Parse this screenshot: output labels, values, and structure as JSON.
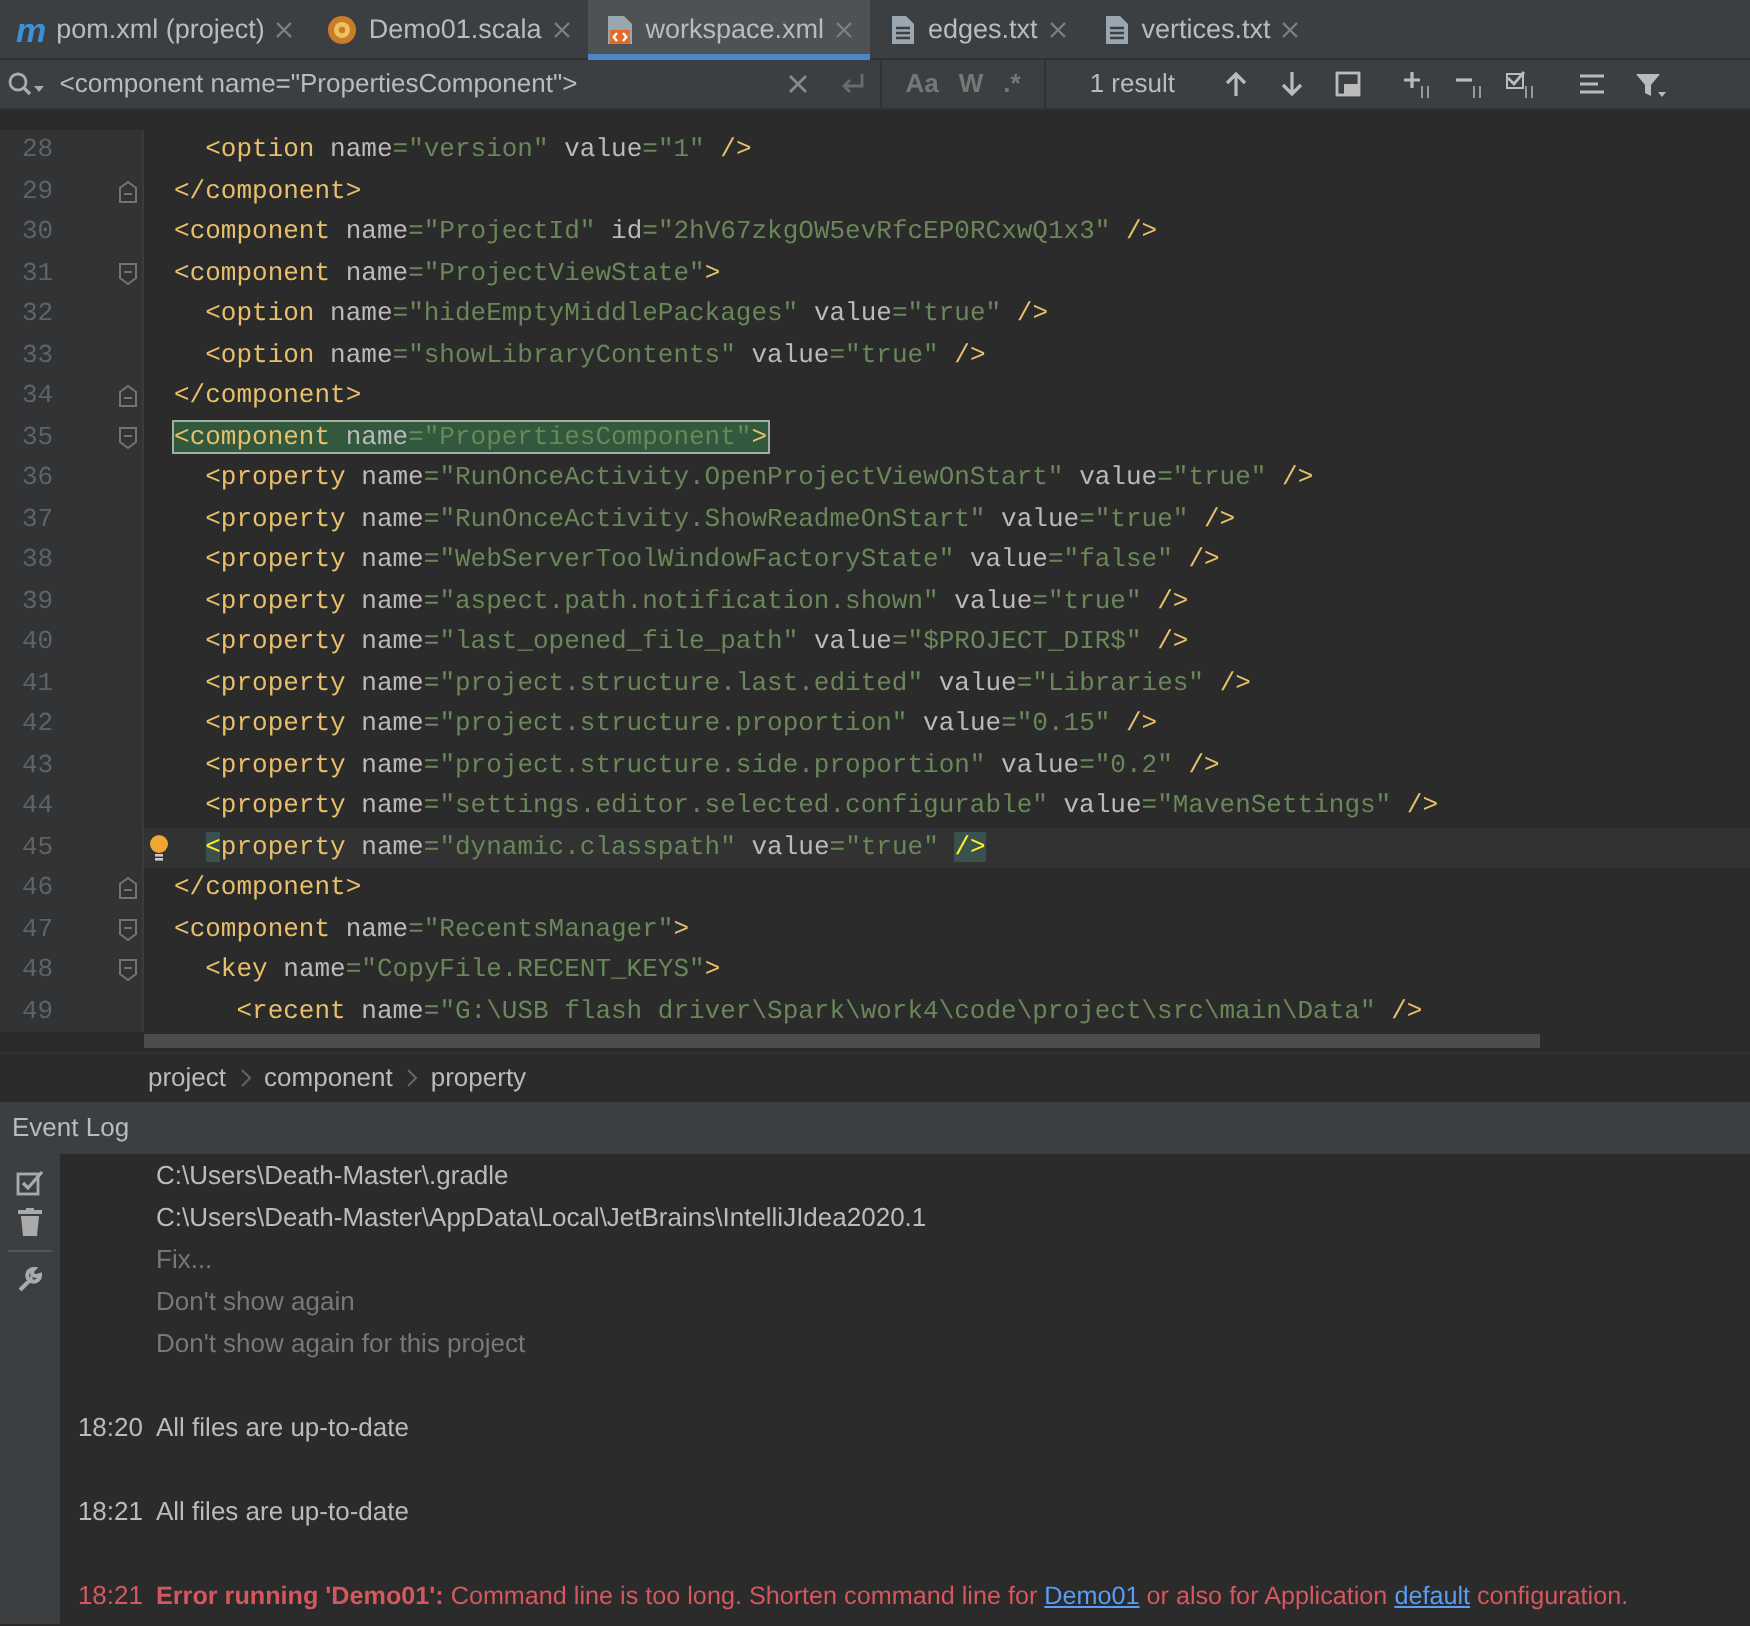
{
  "tabs": [
    {
      "label": "pom.xml (project)",
      "kind": "maven",
      "glyph": "m",
      "selected": false
    },
    {
      "label": "Demo01.scala",
      "kind": "scala",
      "selected": false
    },
    {
      "label": "workspace.xml",
      "kind": "xml",
      "selected": true
    },
    {
      "label": "edges.txt",
      "kind": "text",
      "selected": false
    },
    {
      "label": "vertices.txt",
      "kind": "text",
      "selected": false
    }
  ],
  "find_bar": {
    "query": "<component name=\"PropertiesComponent\">",
    "toggles": [
      {
        "label": "Aa",
        "selected": false
      },
      {
        "label": "W",
        "selected": false
      },
      {
        "label": ".*",
        "selected": false
      }
    ],
    "result": "1 result"
  },
  "editor": {
    "lines": [
      {
        "number": "28",
        "kind": "plain",
        "text": "  <option name=\"version\" value=\"1\" />"
      },
      {
        "number": "29",
        "kind": "fold_end",
        "text": "</component>"
      },
      {
        "number": "30",
        "kind": "plain",
        "text": "<component name=\"ProjectId\" id=\"2hV67zkgOW5evRfcEP0RCxwQ1x3\" />"
      },
      {
        "number": "31",
        "kind": "fold_start",
        "text": "<component name=\"ProjectViewState\">"
      },
      {
        "number": "32",
        "kind": "plain",
        "text": "  <option name=\"hideEmptyMiddlePackages\" value=\"true\" />"
      },
      {
        "number": "33",
        "kind": "plain",
        "text": "  <option name=\"showLibraryContents\" value=\"true\" />"
      },
      {
        "number": "34",
        "kind": "fold_end",
        "text": "</component>"
      },
      {
        "number": "35",
        "kind": "fold_start",
        "text": "<component name=\"PropertiesComponent\">",
        "search_match": true
      },
      {
        "number": "36",
        "kind": "plain",
        "text": "  <property name=\"RunOnceActivity.OpenProjectViewOnStart\" value=\"true\" />"
      },
      {
        "number": "37",
        "kind": "plain",
        "text": "  <property name=\"RunOnceActivity.ShowReadmeOnStart\" value=\"true\" />"
      },
      {
        "number": "38",
        "kind": "plain",
        "text": "  <property name=\"WebServerToolWindowFactoryState\" value=\"false\" />"
      },
      {
        "number": "39",
        "kind": "plain",
        "text": "  <property name=\"aspect.path.notification.shown\" value=\"true\" />"
      },
      {
        "number": "40",
        "kind": "plain",
        "text": "  <property name=\"last_opened_file_path\" value=\"$PROJECT_DIR$\" />"
      },
      {
        "number": "41",
        "kind": "plain",
        "text": "  <property name=\"project.structure.last.edited\" value=\"Libraries\" />"
      },
      {
        "number": "42",
        "kind": "plain",
        "text": "  <property name=\"project.structure.proportion\" value=\"0.15\" />"
      },
      {
        "number": "43",
        "kind": "plain",
        "text": "  <property name=\"project.structure.side.proportion\" value=\"0.2\" />"
      },
      {
        "number": "44",
        "kind": "plain",
        "text": "  <property name=\"settings.editor.selected.configurable\" value=\"MavenSettings\" />"
      },
      {
        "number": "45",
        "kind": "plain",
        "text": "  <property name=\"dynamic.classpath\" value=\"true\" />",
        "current": true
      },
      {
        "number": "46",
        "kind": "fold_end",
        "text": "</component>"
      },
      {
        "number": "47",
        "kind": "fold_start",
        "text": "<component name=\"RecentsManager\">"
      },
      {
        "number": "48",
        "kind": "fold_start",
        "text": "  <key name=\"CopyFile.RECENT_KEYS\">"
      },
      {
        "number": "49",
        "kind": "plain",
        "text": "    <recent name=\"G:\\USB flash driver\\Spark\\work4\\code\\project\\src\\main\\Data\" />"
      }
    ]
  },
  "breadcrumbs": [
    "project",
    "component",
    "property"
  ],
  "event_log": {
    "title": "Event Log",
    "entries": [
      {
        "error": false,
        "lines": [
          {
            "kind": "message",
            "text": "C:\\Users\\Death-Master\\.gradle"
          },
          {
            "kind": "message",
            "text": "C:\\Users\\Death-Master\\AppData\\Local\\JetBrains\\IntelliJIdea2020.1"
          },
          {
            "kind": "action",
            "text": "Fix..."
          },
          {
            "kind": "action",
            "text": "Don't show again"
          },
          {
            "kind": "action",
            "text": "Don't show again for this project"
          }
        ]
      },
      {
        "time": "18:20",
        "error": false,
        "lines": [
          {
            "kind": "message",
            "text": "All files are up-to-date"
          }
        ]
      },
      {
        "time": "18:21",
        "error": false,
        "lines": [
          {
            "kind": "message",
            "text": "All files are up-to-date"
          }
        ]
      },
      {
        "time": "18:21",
        "error": true,
        "lines": [
          {
            "kind": "rich",
            "segments": [
              {
                "kind": "bold",
                "text": "Error running 'Demo01':"
              },
              {
                "kind": "text",
                "text": " Command line is too long. Shorten command line for "
              },
              {
                "kind": "link",
                "text": "Demo01"
              },
              {
                "kind": "text",
                "text": " or also for Application "
              },
              {
                "kind": "link",
                "text": "default"
              },
              {
                "kind": "text",
                "text": " configuration."
              }
            ]
          }
        ]
      }
    ]
  }
}
